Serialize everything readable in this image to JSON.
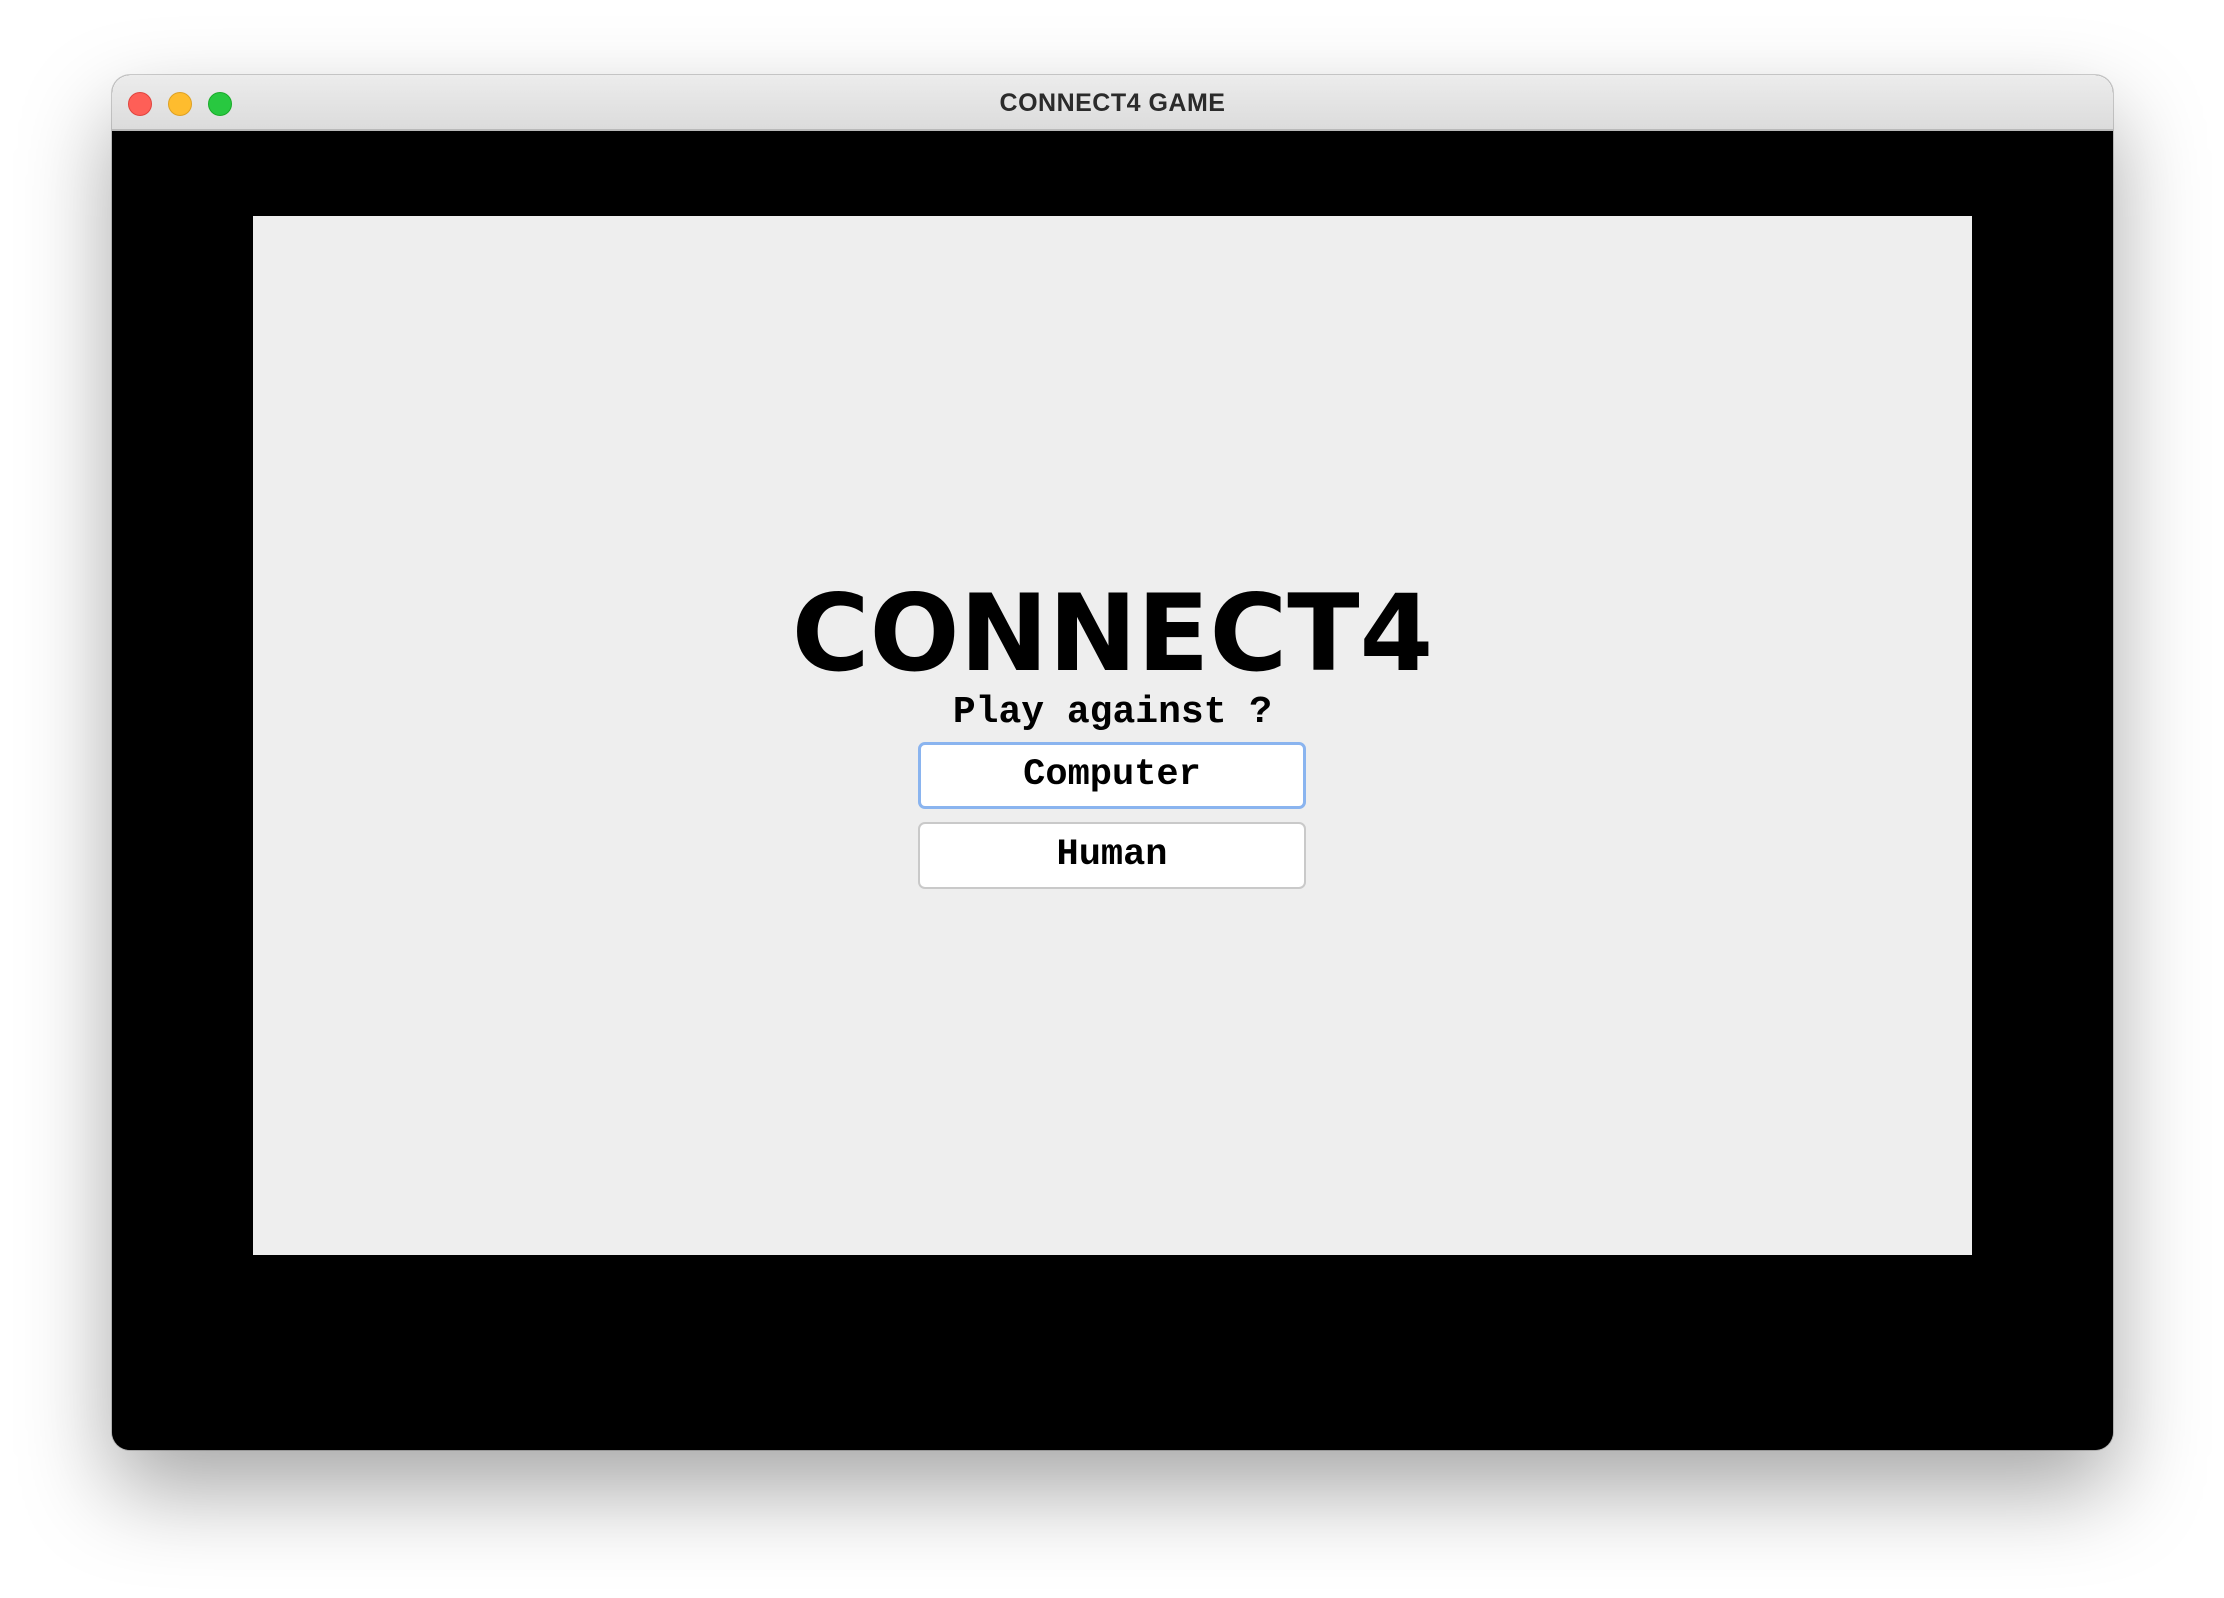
{
  "window": {
    "title": "CONNECT4 GAME"
  },
  "menu": {
    "title": "CONNECT4",
    "prompt": "Play against ?",
    "options": [
      {
        "label": "Computer",
        "focused": true
      },
      {
        "label": "Human",
        "focused": false
      }
    ]
  },
  "colors": {
    "backdrop": "#000000",
    "panel": "#eeeeee",
    "focus_ring": "#8ab4ef"
  }
}
